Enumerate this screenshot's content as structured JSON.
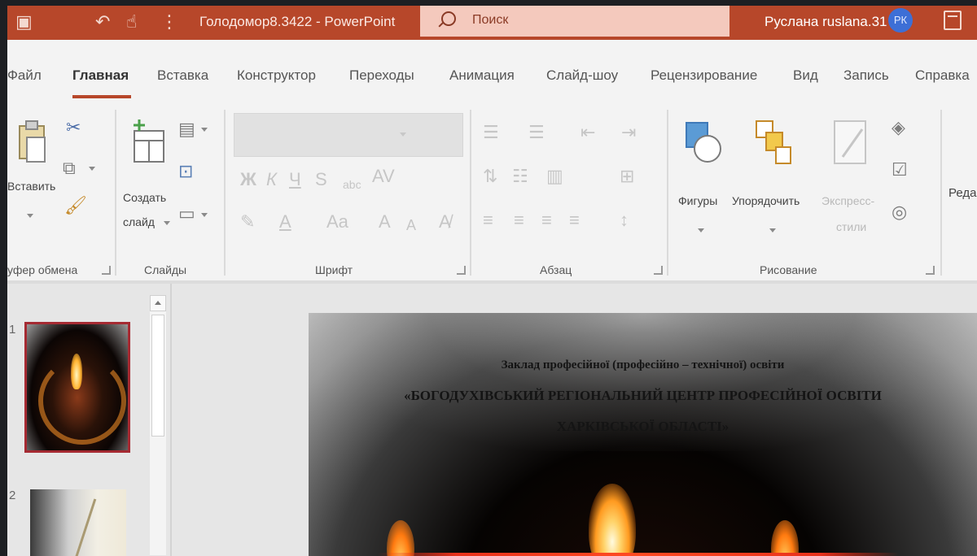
{
  "titlebar": {
    "document_title": "Голодомор8.3422 - PowerPoint",
    "search_placeholder": "Поиск",
    "user_name": "Руслана ruslana.31",
    "avatar_initials": "РК"
  },
  "tabs": [
    {
      "label": "Файл"
    },
    {
      "label": "Главная",
      "active": true
    },
    {
      "label": "Вставка"
    },
    {
      "label": "Конструктор"
    },
    {
      "label": "Переходы"
    },
    {
      "label": "Анимация"
    },
    {
      "label": "Слайд-шоу"
    },
    {
      "label": "Рецензирование"
    },
    {
      "label": "Вид"
    },
    {
      "label": "Запись"
    },
    {
      "label": "Справка"
    }
  ],
  "ribbon": {
    "clipboard": {
      "group_label": "уфер обмена",
      "paste_label": "Вставить"
    },
    "slides": {
      "group_label": "Слайды",
      "new_slide_label_1": "Создать",
      "new_slide_label_2": "слайд"
    },
    "font": {
      "group_label": "Шрифт",
      "bold": "Ж",
      "italic": "К",
      "underline": "Ч",
      "strike": "S",
      "spacing": "AV",
      "case": "Aa",
      "grow": "A",
      "shrink": "A"
    },
    "paragraph": {
      "group_label": "Абзац"
    },
    "drawing": {
      "group_label": "Рисование",
      "shapes_label": "Фигуры",
      "arrange_label": "Упорядочить",
      "quick_styles_label_1": "Экспресс-",
      "quick_styles_label_2": "стили"
    },
    "editing": {
      "label": "Реда"
    }
  },
  "thumbnails": [
    {
      "number": "1",
      "selected": true
    },
    {
      "number": "2",
      "selected": false
    }
  ],
  "slide": {
    "line1": "Заклад професійної (професійно – технічної) освіти",
    "line2": "«БОГОДУХІВСЬКИЙ РЕГІОНАЛЬНИЙ ЦЕНТР ПРОФЕСІЙНОЇ ОСВІТИ",
    "line3": "ХАРКІВСЬКОЇ ОБЛАСТІ»"
  },
  "colors": {
    "accent": "#b7472a",
    "selection": "#a52a32",
    "ribbon_bg": "#f3f3f3"
  }
}
